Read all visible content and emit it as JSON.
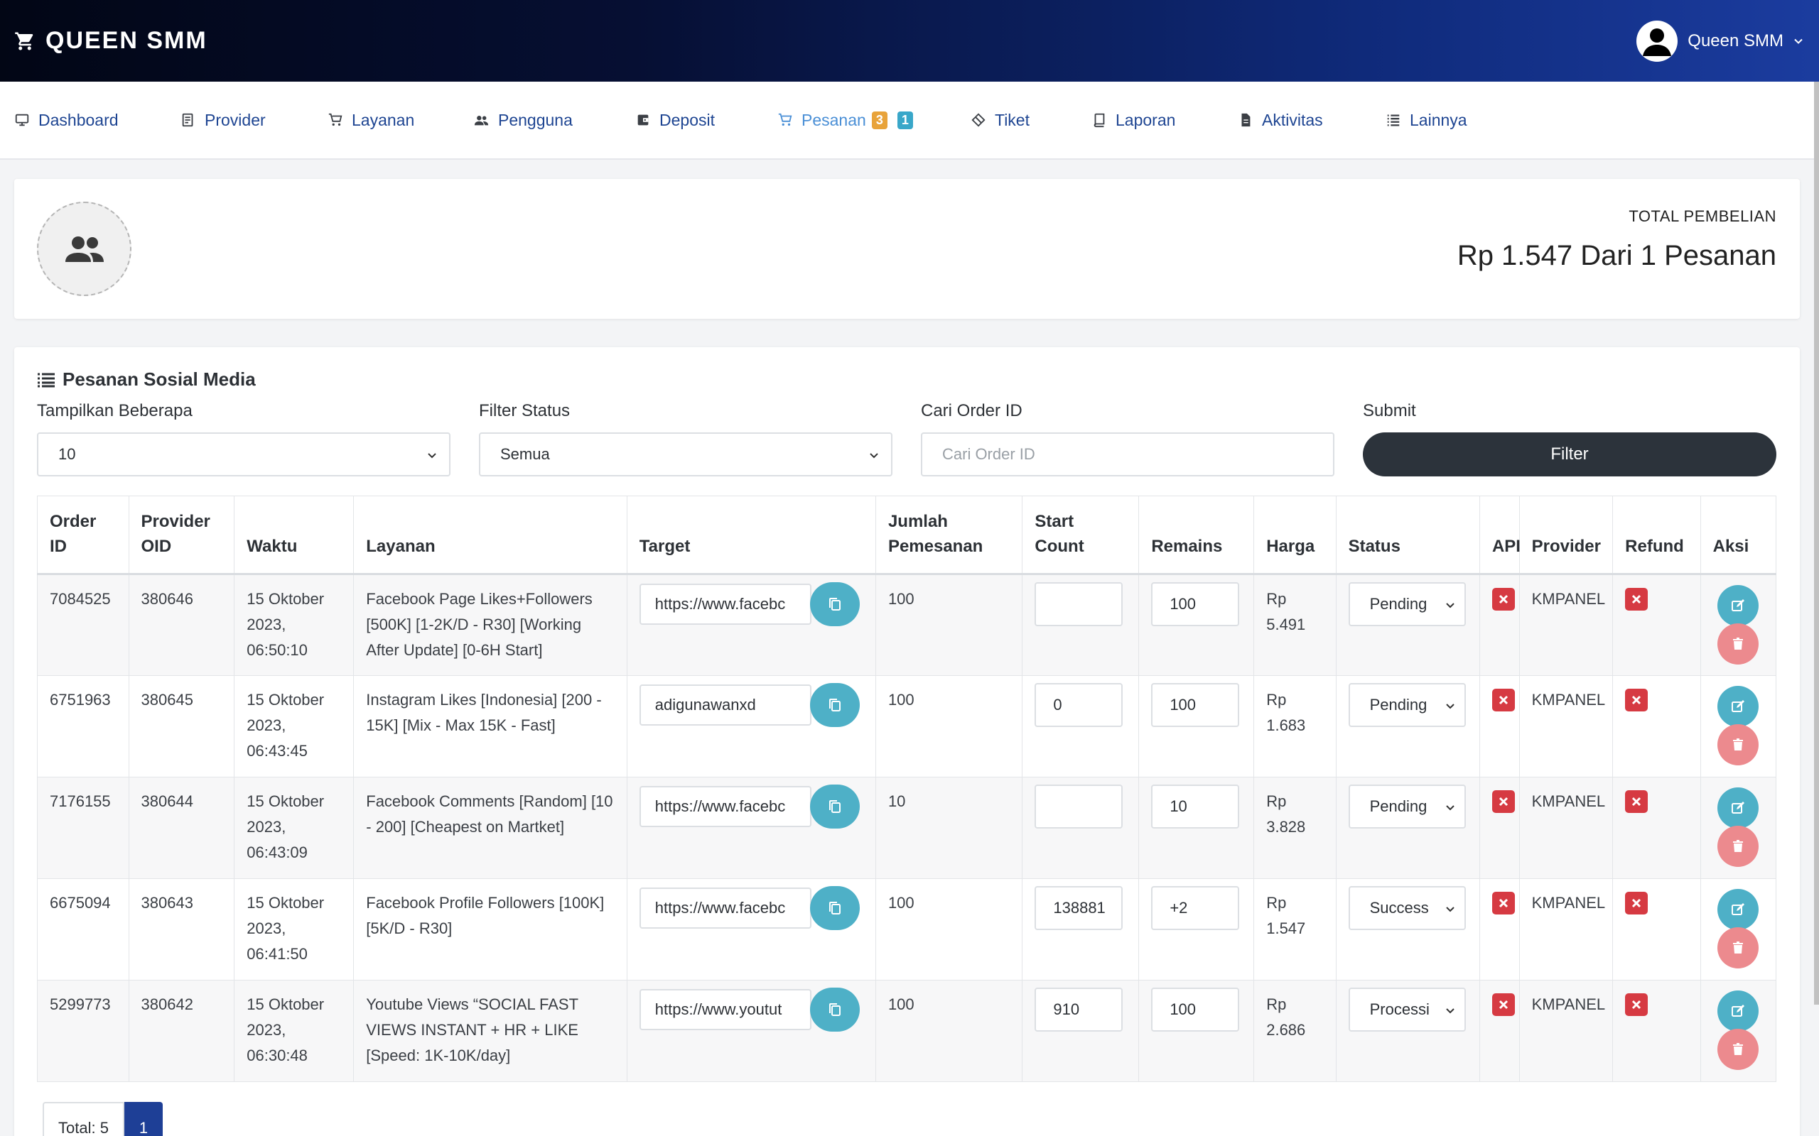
{
  "header": {
    "brand": "QUEEN SMM",
    "user_name": "Queen SMM"
  },
  "nav": [
    {
      "label": "Dashboard",
      "icon": "monitor-icon"
    },
    {
      "label": "Provider",
      "icon": "server-icon"
    },
    {
      "label": "Layanan",
      "icon": "cart-icon"
    },
    {
      "label": "Pengguna",
      "icon": "users-icon"
    },
    {
      "label": "Deposit",
      "icon": "wallet-icon"
    },
    {
      "label": "Pesanan",
      "icon": "cart-icon",
      "badges": [
        "3",
        "1"
      ]
    },
    {
      "label": "Tiket",
      "icon": "ticket-icon"
    },
    {
      "label": "Laporan",
      "icon": "book-icon"
    },
    {
      "label": "Aktivitas",
      "icon": "file-icon"
    },
    {
      "label": "Lainnya",
      "icon": "list-icon"
    }
  ],
  "summary": {
    "label": "TOTAL PEMBELIAN",
    "value": "Rp 1.547 Dari 1 Pesanan"
  },
  "orders": {
    "title": "Pesanan Sosial Media",
    "filters": {
      "show_label": "Tampilkan Beberapa",
      "show_value": "10",
      "status_label": "Filter Status",
      "status_value": "Semua",
      "search_label": "Cari Order ID",
      "search_placeholder": "Cari Order ID",
      "submit_label": "Submit",
      "filter_button": "Filter"
    },
    "columns": [
      "Order ID",
      "Provider OID",
      "Waktu",
      "Layanan",
      "Target",
      "Jumlah Pemesanan",
      "Start Count",
      "Remains",
      "Harga",
      "Status",
      "API",
      "Provider",
      "Refund",
      "Aksi"
    ],
    "rows": [
      {
        "order_id": "7084525",
        "provider_oid": "380646",
        "waktu": "15 Oktober 2023, 06:50:10",
        "layanan": "Facebook Page Likes+Followers [500K] [1-2K/D - R30] [Working After Update] [0-6H Start]",
        "target": "https://www.facebc",
        "jumlah": "100",
        "start_count": "",
        "remains": "100",
        "harga": "Rp 5.491",
        "status": "Pending",
        "provider": "KMPANEL"
      },
      {
        "order_id": "6751963",
        "provider_oid": "380645",
        "waktu": "15 Oktober 2023, 06:43:45",
        "layanan": "Instagram Likes [Indonesia] [200 - 15K] [Mix - Max 15K - Fast]",
        "target": "adigunawanxd",
        "jumlah": "100",
        "start_count": "0",
        "remains": "100",
        "harga": "Rp 1.683",
        "status": "Pending",
        "provider": "KMPANEL"
      },
      {
        "order_id": "7176155",
        "provider_oid": "380644",
        "waktu": "15 Oktober 2023, 06:43:09",
        "layanan": "Facebook Comments [Random] [10 - 200] [Cheapest on Martket]",
        "target": "https://www.facebc",
        "jumlah": "10",
        "start_count": "",
        "remains": "10",
        "harga": "Rp 3.828",
        "status": "Pending",
        "provider": "KMPANEL"
      },
      {
        "order_id": "6675094",
        "provider_oid": "380643",
        "waktu": "15 Oktober 2023, 06:41:50",
        "layanan": "Facebook Profile Followers [100K] [5K/D - R30]",
        "target": "https://www.facebc",
        "jumlah": "100",
        "start_count": "138881",
        "remains": "+2",
        "harga": "Rp 1.547",
        "status": "Success",
        "provider": "KMPANEL"
      },
      {
        "order_id": "5299773",
        "provider_oid": "380642",
        "waktu": "15 Oktober 2023, 06:30:48",
        "layanan": "Youtube Views “SOCIAL FAST VIEWS INSTANT + HR + LIKE [Speed: 1K-10K/day]",
        "target": "https://www.youtut",
        "jumlah": "100",
        "start_count": "910",
        "remains": "100",
        "harga": "Rp 2.686",
        "status": "Processi",
        "provider": "KMPANEL"
      }
    ]
  },
  "pagination": {
    "total": "Total: 5",
    "current_page": "1"
  },
  "colors": {
    "header_dark": "#020615",
    "header_blue": "#1b3c9f",
    "nav_text": "#1e4592",
    "nav_active": "#4a8fd6",
    "filter_button": "#2c333b",
    "copy_button": "#4eb0c7",
    "delete_button": "#ec8a8e",
    "x_icon": "#d63a42",
    "page_active": "#1e3f96"
  }
}
